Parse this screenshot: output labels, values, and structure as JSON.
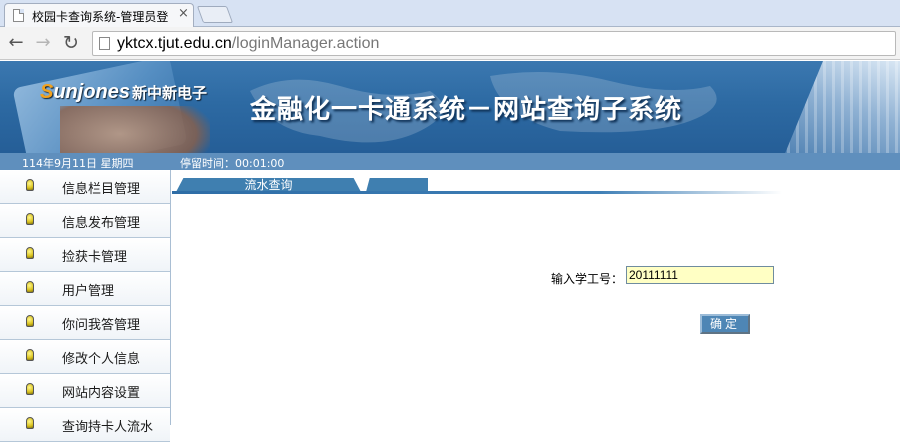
{
  "browser": {
    "tab_title": "校园卡查询系统-管理员登",
    "tab_close": "×",
    "url_host": "yktcx.tjut.edu.cn",
    "url_path": "/loginManager.action"
  },
  "banner": {
    "logo_prefix": "S",
    "logo_main": "unjones",
    "logo_cn": "新中新电子",
    "title": "金融化一卡通系统－网站查询子系统"
  },
  "status": {
    "date": "114年9月11日 星期四",
    "dwell": "停留时间：00:01:00"
  },
  "sidebar": {
    "items": [
      {
        "label": "信息栏目管理"
      },
      {
        "label": "信息发布管理"
      },
      {
        "label": "捡获卡管理"
      },
      {
        "label": "用户管理"
      },
      {
        "label": "你问我答管理"
      },
      {
        "label": "修改个人信息"
      },
      {
        "label": "网站内容设置"
      },
      {
        "label": "查询持卡人流水"
      }
    ]
  },
  "content": {
    "tabs": [
      {
        "label": "流水查询"
      },
      {
        "label": ""
      }
    ],
    "field_label": "输入学工号：",
    "student_id_value": "20111111",
    "ok_label": "确定"
  }
}
